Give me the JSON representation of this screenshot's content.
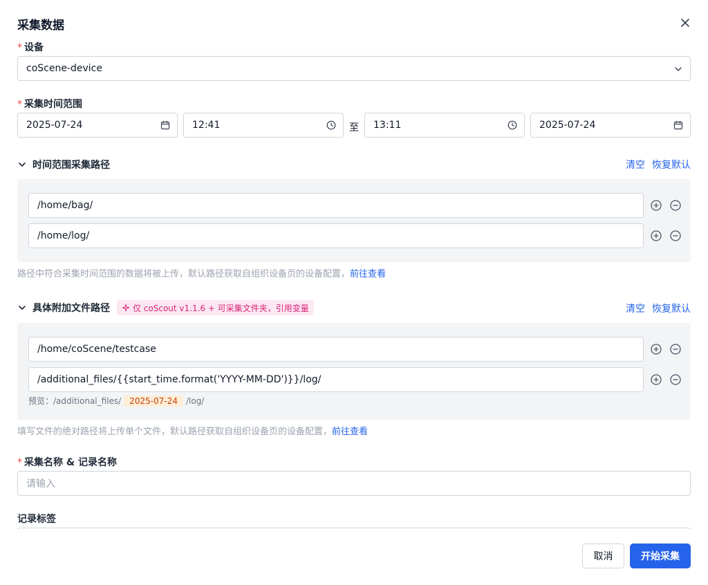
{
  "dialog": {
    "title": "采集数据"
  },
  "device": {
    "label": "设备",
    "value": "coScene-device"
  },
  "time_range": {
    "label": "采集时间范围",
    "start_date": "2025-07-24",
    "start_time": "12:41",
    "separator": "至",
    "end_time": "13:11",
    "end_date": "2025-07-24"
  },
  "time_paths": {
    "title": "时间范围采集路径",
    "clear": "清空",
    "restore": "恢复默认",
    "paths": [
      "/home/bag/",
      "/home/log/"
    ],
    "hint": "路径中符合采集时间范围的数据将被上传，默认路径获取自组织设备页的设备配置，",
    "hint_link": "前往查看"
  },
  "extra_paths": {
    "title": "具体附加文件路径",
    "tag": "仅 coScout v1.1.6 + 可采集文件夹，引用变量",
    "clear": "清空",
    "restore": "恢复默认",
    "paths": [
      "/home/coScene/testcase",
      "/additional_files/{{start_time.format('YYYY-MM-DD')}}/log/"
    ],
    "preview_label": "预览：/additional_files/",
    "preview_date": "2025-07-24",
    "preview_suffix": "/log/",
    "hint": "填写文件的绝对路径将上传单个文件，默认路径获取自组织设备页的设备配置，",
    "hint_link": "前往查看"
  },
  "record_name": {
    "label": "采集名称 & 记录名称",
    "placeholder": "请输入"
  },
  "record_tags": {
    "label": "记录标签"
  },
  "footer": {
    "cancel": "取消",
    "start": "开始采集"
  },
  "colors": {
    "primary": "#2563eb",
    "required": "#ef4444",
    "tag_bg": "#fce7f3",
    "tag_text": "#db2777"
  }
}
